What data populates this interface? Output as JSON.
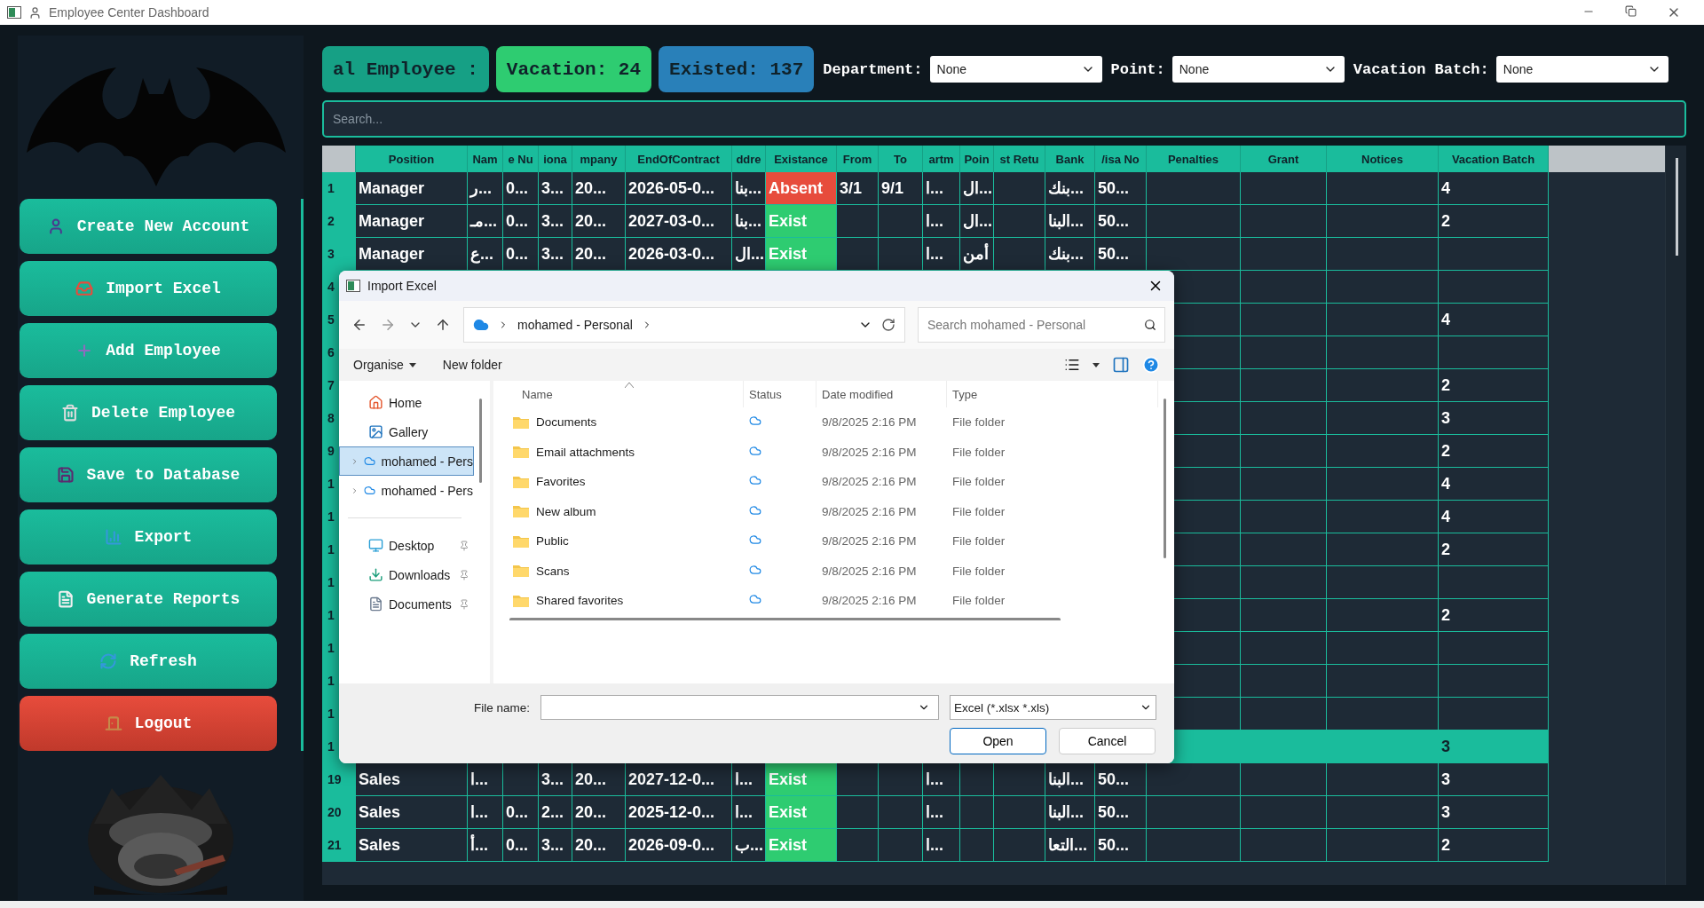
{
  "window": {
    "title": "Employee Center Dashboard"
  },
  "sidebar": {
    "buttons": [
      {
        "label": "Create New Account",
        "kind": "primary"
      },
      {
        "label": "Import Excel",
        "kind": "primary"
      },
      {
        "label": "Add Employee",
        "kind": "primary"
      },
      {
        "label": "Delete Employee",
        "kind": "primary"
      },
      {
        "label": "Save to Database",
        "kind": "primary"
      },
      {
        "label": "Export",
        "kind": "primary"
      },
      {
        "label": "Generate Reports",
        "kind": "primary"
      },
      {
        "label": "Refresh",
        "kind": "primary"
      },
      {
        "label": "Logout",
        "kind": "danger"
      }
    ]
  },
  "stats": [
    {
      "label": "al Employee :",
      "color": "#16a085"
    },
    {
      "label": "Vacation: 24",
      "color": "#2ecc71"
    },
    {
      "label": "Existed: 137",
      "color": "#2980b9"
    }
  ],
  "filters": [
    {
      "label": "Department:",
      "value": "None"
    },
    {
      "label": "Point:",
      "value": "None"
    },
    {
      "label": "Vacation Batch:",
      "value": "None"
    }
  ],
  "search": {
    "placeholder": "Search..."
  },
  "table": {
    "columns": [
      "Position",
      "Nam",
      "e Nu",
      "iona",
      "mpany",
      "EndOfContract",
      "ddre",
      "Existance",
      "From",
      "To",
      "artm",
      "Poin",
      "st Retu",
      "Bank",
      "/isa No",
      "Penalties",
      "Grant",
      "Notices",
      "Vacation Batch"
    ],
    "rows": [
      {
        "number": "1",
        "selected": false,
        "cells": [
          "Manager",
          "ر...",
          "0...",
          "3...",
          "20...",
          "2026-05-0...",
          "بنا...",
          {
            "text": "Absent",
            "color": "#e74c3c"
          },
          "3/1",
          "9/1",
          "ا...",
          "ال...",
          "",
          "بنك...",
          "50...",
          "",
          "",
          "",
          "4"
        ]
      },
      {
        "number": "2",
        "selected": false,
        "cells": [
          "Manager",
          "مـ...",
          "0...",
          "3...",
          "20...",
          "2027-03-0...",
          "بنا...",
          {
            "text": "Exist",
            "color": "#2ecc71"
          },
          "",
          "",
          "ا...",
          "ال...",
          "",
          "البنا...",
          "50...",
          "",
          "",
          "",
          "2"
        ]
      },
      {
        "number": "3",
        "selected": false,
        "cells": [
          "Manager",
          "ع...",
          "0...",
          "3...",
          "20...",
          "2026-03-0...",
          "ال...",
          {
            "text": "Exist",
            "color": "#2ecc71"
          },
          "",
          "",
          "ا...",
          "أمن",
          "",
          "بنك...",
          "50...",
          "",
          "",
          "",
          ""
        ]
      },
      {
        "number": "4",
        "selected": false,
        "vacation_batch": ""
      },
      {
        "number": "5",
        "selected": false,
        "vacation_batch": "4"
      },
      {
        "number": "6",
        "selected": false,
        "vacation_batch": ""
      },
      {
        "number": "7",
        "selected": false,
        "vacation_batch": "2"
      },
      {
        "number": "8",
        "selected": false,
        "vacation_batch": "3"
      },
      {
        "number": "9",
        "selected": false,
        "vacation_batch": "2"
      },
      {
        "number": "1",
        "selected": false,
        "vacation_batch": "4"
      },
      {
        "number": "1",
        "selected": false,
        "vacation_batch": "4"
      },
      {
        "number": "1",
        "selected": false,
        "vacation_batch": "2"
      },
      {
        "number": "1",
        "selected": false,
        "vacation_batch": ""
      },
      {
        "number": "1",
        "selected": false,
        "vacation_batch": "2"
      },
      {
        "number": "1",
        "selected": false,
        "vacation_batch": ""
      },
      {
        "number": "1",
        "selected": false,
        "vacation_batch": ""
      },
      {
        "number": "1",
        "selected": false,
        "vacation_batch": ""
      },
      {
        "number": "1",
        "selected": true,
        "vacation_batch": "3"
      },
      {
        "number": "19",
        "selected": false,
        "cells": [
          "Sales",
          "ا...",
          "",
          "3...",
          "20...",
          "2027-12-0...",
          "ا...",
          {
            "text": "Exist",
            "color": "#2ecc71"
          },
          "",
          "",
          "ا...",
          "",
          "",
          "البنا...",
          "50...",
          "",
          "",
          "",
          "3"
        ]
      },
      {
        "number": "20",
        "selected": false,
        "cells": [
          "Sales",
          "ا...",
          "0...",
          "2...",
          "20...",
          "2025-12-0...",
          "ا...",
          {
            "text": "Exist",
            "color": "#2ecc71"
          },
          "",
          "",
          "ا...",
          "",
          "",
          "البنا...",
          "50...",
          "",
          "",
          "",
          "3"
        ]
      },
      {
        "number": "21",
        "selected": false,
        "cells": [
          "Sales",
          "أ...",
          "0...",
          "3...",
          "20...",
          "2026-09-0...",
          "ب...",
          {
            "text": "Exist",
            "color": "#2ecc71"
          },
          "",
          "",
          "ا...",
          "",
          "",
          "التعا...",
          "50...",
          "",
          "",
          "",
          "2"
        ]
      }
    ]
  },
  "dialog": {
    "title": "Import Excel",
    "address": "mohamed - Personal",
    "search_placeholder": "Search mohamed - Personal",
    "commands": [
      "Organise",
      "New folder"
    ],
    "nav_items": [
      {
        "label": "Home",
        "kind": "plain",
        "selected": false
      },
      {
        "label": "Gallery",
        "kind": "plain",
        "selected": false
      },
      {
        "label": "mohamed - Pers",
        "kind": "expandable",
        "selected": true
      },
      {
        "label": "mohamed - Pers",
        "kind": "expandable",
        "selected": false
      },
      {
        "label": "Desktop",
        "kind": "pinned",
        "selected": false
      },
      {
        "label": "Downloads",
        "kind": "pinned",
        "selected": false
      },
      {
        "label": "Documents",
        "kind": "pinned",
        "selected": false
      }
    ],
    "columns": [
      "Name",
      "Status",
      "Date modified",
      "Type"
    ],
    "files": [
      {
        "name": "Documents",
        "date": "9/8/2025 2:16 PM",
        "type": "File folder"
      },
      {
        "name": "Email attachments",
        "date": "9/8/2025 2:16 PM",
        "type": "File folder"
      },
      {
        "name": "Favorites",
        "date": "9/8/2025 2:16 PM",
        "type": "File folder"
      },
      {
        "name": "New album",
        "date": "9/8/2025 2:16 PM",
        "type": "File folder"
      },
      {
        "name": "Public",
        "date": "9/8/2025 2:16 PM",
        "type": "File folder"
      },
      {
        "name": "Scans",
        "date": "9/8/2025 2:16 PM",
        "type": "File folder"
      },
      {
        "name": "Shared favorites",
        "date": "9/8/2025 2:16 PM",
        "type": "File folder"
      }
    ],
    "file_name_label": "File name:",
    "file_type": "Excel (*.xlsx *.xls)",
    "buttons": [
      "Open",
      "Cancel"
    ]
  }
}
